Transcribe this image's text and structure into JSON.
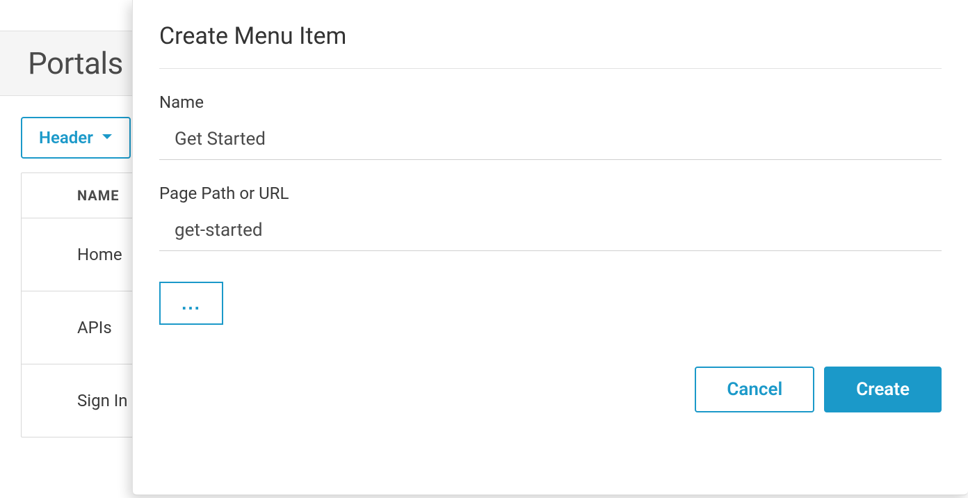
{
  "page": {
    "title": "Portals"
  },
  "header_dropdown": {
    "label": "Header"
  },
  "table": {
    "name_header": "NAME",
    "rows": [
      {
        "name": "Home"
      },
      {
        "name": "APIs"
      },
      {
        "name": "Sign In"
      }
    ]
  },
  "modal": {
    "title": "Create Menu Item",
    "name_label": "Name",
    "name_value": "Get Started",
    "path_label": "Page Path or URL",
    "path_value": "get-started",
    "more_label": "...",
    "cancel_label": "Cancel",
    "create_label": "Create"
  }
}
